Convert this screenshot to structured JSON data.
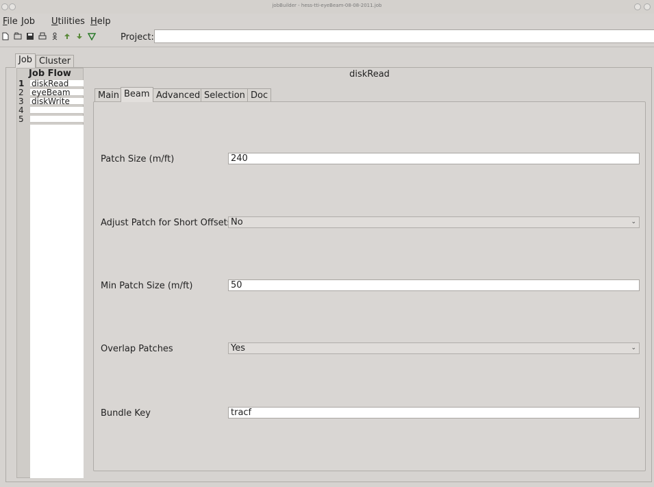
{
  "window": {
    "title": "jobBuilder - hess-tti-eyeBeam-08-08-2011.job"
  },
  "menubar": {
    "items": [
      {
        "label": "File",
        "mnemonic": "F",
        "rest": "ile"
      },
      {
        "label": "Job",
        "mnemonic": "J",
        "rest": "ob"
      },
      {
        "label": "Utilities",
        "mnemonic": "U",
        "rest": "tilities"
      },
      {
        "label": "Help",
        "mnemonic": "H",
        "rest": "elp"
      }
    ]
  },
  "toolbar": {
    "icons": [
      "new-icon",
      "open-icon",
      "save-icon",
      "print-icon",
      "run-icon",
      "up-icon",
      "down-icon",
      "filter-icon"
    ],
    "project_label": "Project:",
    "project_value": ""
  },
  "outer_tabs": [
    {
      "label": "Job"
    },
    {
      "label": "Cluster"
    }
  ],
  "job_flow": {
    "header": "Job Flow",
    "rows": [
      {
        "num": "1",
        "name": "diskRead"
      },
      {
        "num": "2",
        "name": "eyeBeam"
      },
      {
        "num": "3",
        "name": "diskWrite"
      },
      {
        "num": "4",
        "name": ""
      },
      {
        "num": "5",
        "name": ""
      }
    ]
  },
  "panel": {
    "title": "diskRead",
    "tabs": [
      {
        "label": "Main"
      },
      {
        "label": "Beam"
      },
      {
        "label": "Advanced"
      },
      {
        "label": "Selection"
      },
      {
        "label": "Doc"
      }
    ],
    "active_tab": "Beam",
    "fields": [
      {
        "label": "Patch Size (m/ft)",
        "type": "text",
        "value": "240"
      },
      {
        "label": "Adjust Patch for Short Offsets",
        "type": "select",
        "value": "No"
      },
      {
        "label": "Min Patch Size (m/ft)",
        "type": "text",
        "value": "50"
      },
      {
        "label": "Overlap Patches",
        "type": "select",
        "value": "Yes"
      },
      {
        "label": "Bundle Key",
        "type": "text",
        "value": "tracf"
      }
    ]
  }
}
